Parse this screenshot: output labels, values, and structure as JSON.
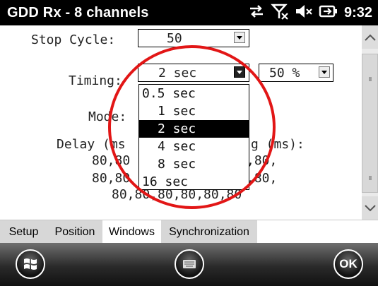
{
  "title_bar": {
    "title": "GDD Rx - 8 channels",
    "time": "9:32",
    "icons": [
      "connectivity-icon",
      "no-signal-icon",
      "volume-icon",
      "battery-charging-icon"
    ]
  },
  "form": {
    "stop_cycle": {
      "label": "Stop Cycle:",
      "value": "50"
    },
    "timing": {
      "label": "Timing:",
      "value": "2 sec"
    },
    "timing_percent": {
      "value": "50 %"
    },
    "mode": {
      "label": "Mode:"
    },
    "delay_label": "Delay (ms",
    "delay_suffix_label": "g (ms):",
    "delay_values": {
      "row1_left": "80,80",
      "row1_right": ",80,",
      "row2_left": "80,80",
      "row2_right": ",80,",
      "row3": "80,80,80,80,80,80"
    }
  },
  "timing_dropdown": {
    "options": [
      "0.5 sec",
      "1 sec",
      "2 sec",
      "4 sec",
      "8 sec",
      "16 sec"
    ],
    "selected": "2 sec"
  },
  "tabs": [
    {
      "label": "Setup"
    },
    {
      "label": "Position"
    },
    {
      "label": "Windows"
    },
    {
      "label": "Synchronization"
    }
  ],
  "active_tab": "Windows",
  "bottom_bar": {
    "start_icon": "windows-start-icon",
    "keyboard_icon": "keyboard-icon",
    "ok_label": "OK"
  },
  "annotation_color": "#e21616"
}
